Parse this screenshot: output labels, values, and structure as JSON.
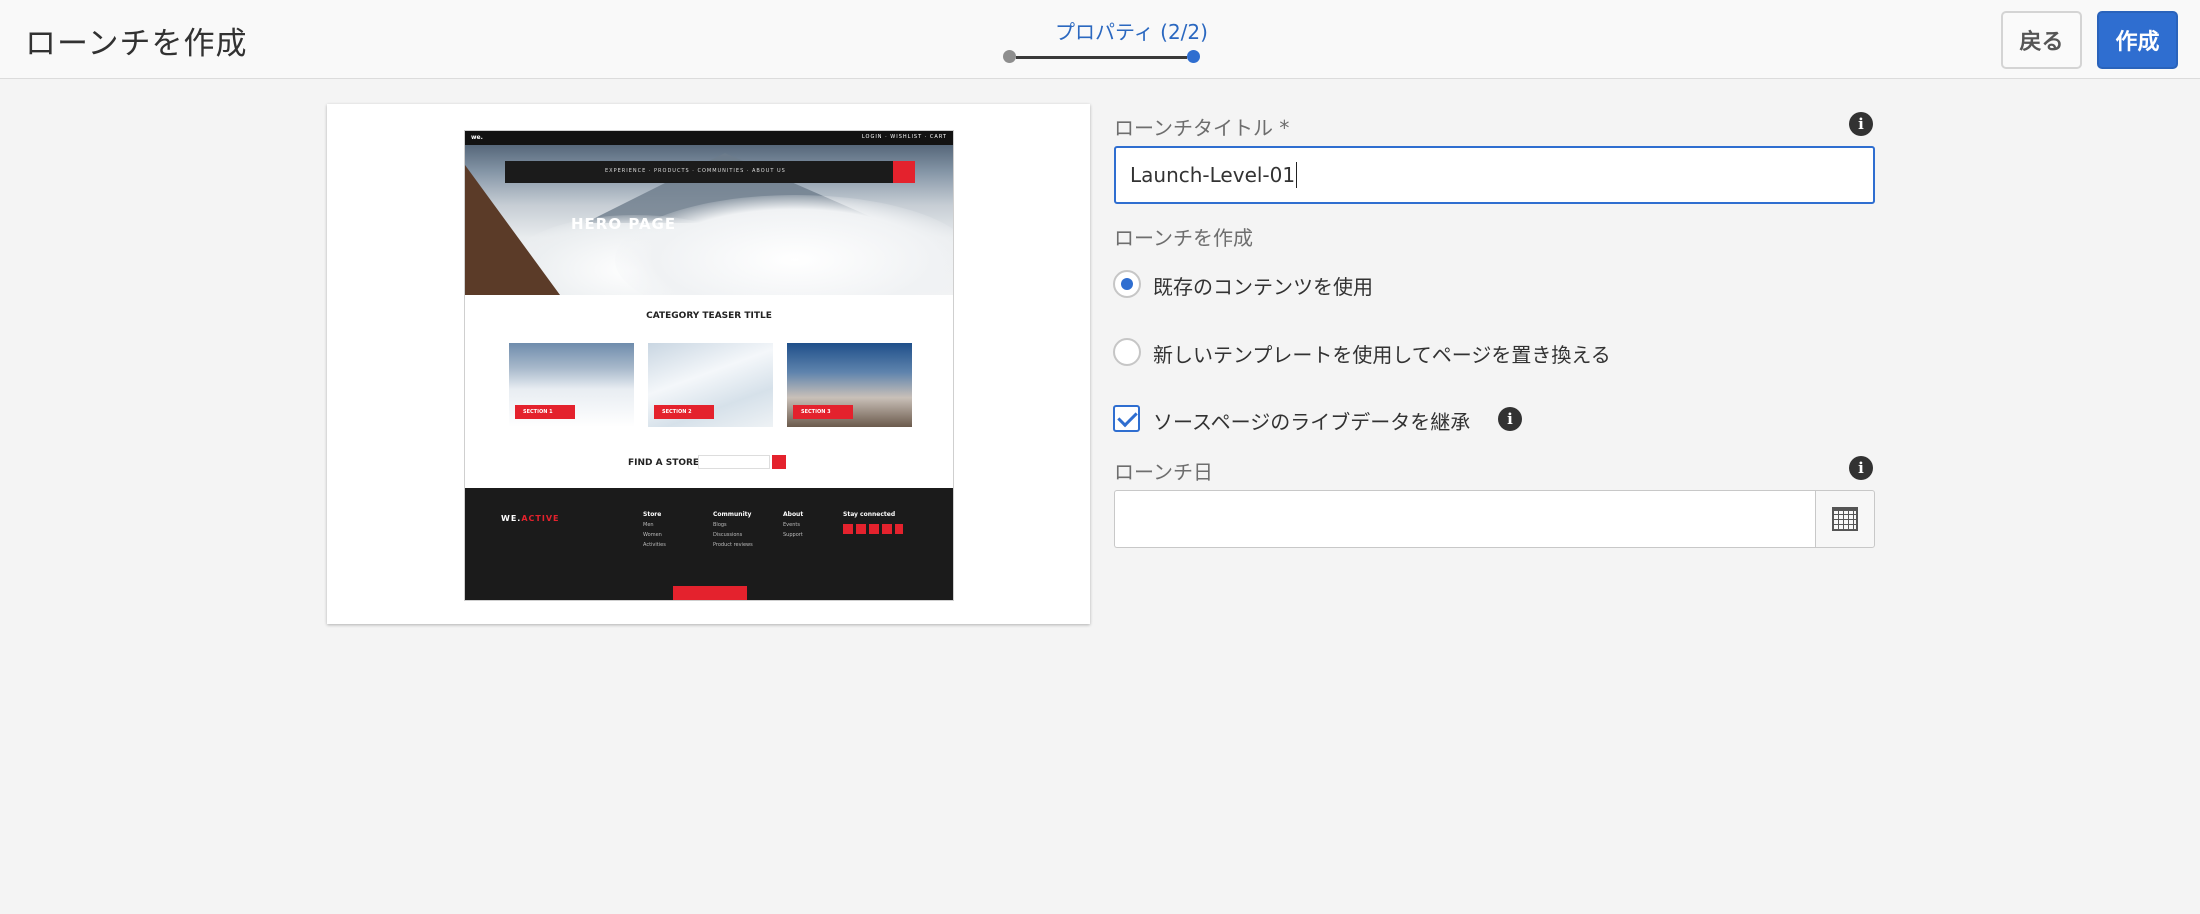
{
  "header": {
    "title": "ローンチを作成",
    "step_label": "プロパティ (2/2)",
    "back_label": "戻る",
    "create_label": "作成"
  },
  "preview": {
    "hero_title": "HERO PAGE",
    "category_title": "CATEGORY TEASER TITLE",
    "tiles": [
      "SECTION 1",
      "SECTION 2",
      "SECTION 3"
    ],
    "find_store": "FIND A STORE",
    "footer_logo_prefix": "WE.",
    "footer_logo_accent": "ACTIVE",
    "footer_columns": [
      {
        "title": "Store",
        "items": [
          "Men",
          "Women",
          "Activities"
        ]
      },
      {
        "title": "Community",
        "items": [
          "Blogs",
          "Discussions",
          "Product reviews"
        ]
      },
      {
        "title": "About",
        "items": [
          "Events",
          "Support"
        ]
      },
      {
        "title": "Stay connected",
        "items": []
      }
    ]
  },
  "form": {
    "title_label": "ローンチタイトル *",
    "title_value": "Launch-Level-01",
    "source_label": "ローンチを作成",
    "options": [
      {
        "label": "既存のコンテンツを使用",
        "checked": true
      },
      {
        "label": "新しいテンプレートを使用してページを置き換える",
        "checked": false
      }
    ],
    "inherit_label": "ソースページのライブデータを継承",
    "inherit_checked": true,
    "date_label": "ローンチ日",
    "date_value": ""
  },
  "icons": {
    "info": "info-icon",
    "calendar": "calendar-icon"
  },
  "colors": {
    "accent": "#2f6ed0",
    "brand_red": "#e4222d"
  }
}
